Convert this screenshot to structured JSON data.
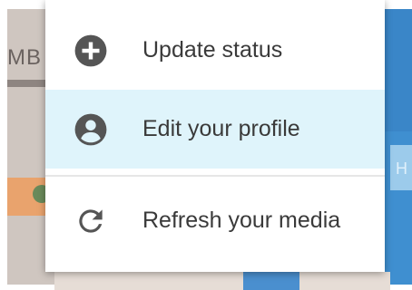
{
  "background": {
    "left_text": "MB",
    "right_text": "H"
  },
  "menu": {
    "items": [
      {
        "label": "Update status",
        "icon": "plus-circle-icon",
        "highlighted": false
      },
      {
        "label": "Edit your profile",
        "icon": "account-circle-icon",
        "highlighted": true
      },
      {
        "label": "Refresh your media",
        "icon": "refresh-icon",
        "highlighted": false
      }
    ]
  },
  "colors": {
    "highlight": "#dff4fb",
    "icon": "#555555",
    "text": "#3a3a3a"
  }
}
